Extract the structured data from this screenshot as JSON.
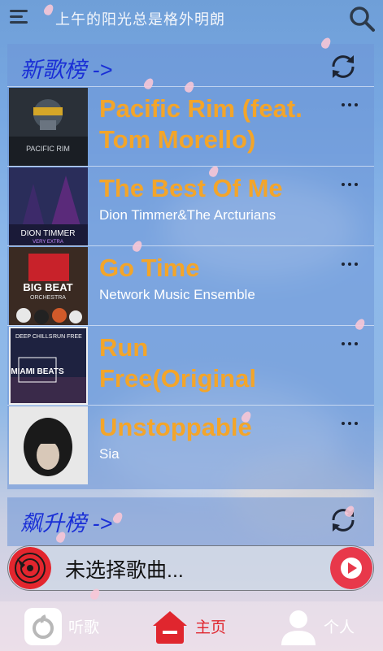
{
  "header": {
    "title": "上午的阳光总是格外明朗"
  },
  "new_songs": {
    "title": "新歌榜 ->",
    "songs": [
      {
        "title": "Pacific Rim (feat. Tom Morello)",
        "artist": ""
      },
      {
        "title": "The Best Of Me",
        "artist": "Dion Timmer&The Arcturians"
      },
      {
        "title": "Go Time",
        "artist": "Network Music Ensemble"
      },
      {
        "title": "Run Free(Original Mix)",
        "artist": ""
      },
      {
        "title": "Unstoppable",
        "artist": "Sia"
      }
    ],
    "covers": [
      {
        "text": "PACIFIC RIM",
        "bg": "#2a3038"
      },
      {
        "text": "DION TIMMER",
        "sub": "VERY EXTRA",
        "bg": "#2a2d5a"
      },
      {
        "text": "BIG BEAT",
        "sub": "ORCHESTRA",
        "bg": "#3a2a22"
      },
      {
        "text": "MIAMI BEATS",
        "top_left": "DEEP CHILLS",
        "top_right": "RUN FREE",
        "bg": "#1e2240"
      },
      {
        "text": "",
        "bg": "#e8e8e8"
      }
    ]
  },
  "rising": {
    "title": "飙升榜 ->"
  },
  "player": {
    "text": "未选择歌曲..."
  },
  "nav": {
    "items": [
      {
        "label": "听歌"
      },
      {
        "label": "主页"
      },
      {
        "label": "个人"
      }
    ]
  },
  "colors": {
    "accent_red": "#e0262e",
    "title_orange": "#f3a52a",
    "panel_title_blue": "#1a2fd6"
  }
}
